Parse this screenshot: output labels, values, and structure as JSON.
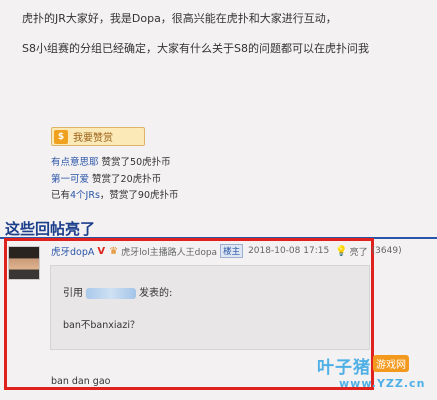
{
  "post": {
    "line1": "虎扑的JR大家好，我是Dopa，很高兴能在虎扑和大家进行互动，",
    "line2": "S8小组赛的分组已经确定，大家有什么关于S8的问题都可以在虎扑问我"
  },
  "reward": {
    "button_label": "我要赞赏",
    "coin_icon": "coin-icon",
    "entries": [
      {
        "user": "有点意思耶",
        "text": "赞赏了50虎扑币"
      },
      {
        "user": "第一可爱",
        "text": "赞赏了20虎扑币"
      }
    ],
    "summary_prefix": "已有",
    "summary_count": "4个JRs",
    "summary_suffix": "，赞赏了90虎扑币"
  },
  "section": {
    "title": "这些回帖亮了"
  },
  "reply": {
    "author": "虎牙dopA",
    "verified_mark": "V",
    "title": "虎牙lol主播路人王dopa",
    "op_badge": "楼主",
    "timestamp": "2018-10-08 17:15",
    "light_label": "亮了",
    "light_count": "(3649)",
    "quote_prefix": "引用",
    "quote_suffix": "发表的:",
    "quote_text": "ban不banxiazi？",
    "text": "ban dan gao"
  },
  "watermark": {
    "logo": "叶子猪",
    "sub": "游戏网",
    "url": "www.YZZ.cn"
  },
  "colors": {
    "link_blue": "#2a55a8",
    "highlight_red": "#e0221e",
    "reward_orange": "#f0a11f"
  }
}
